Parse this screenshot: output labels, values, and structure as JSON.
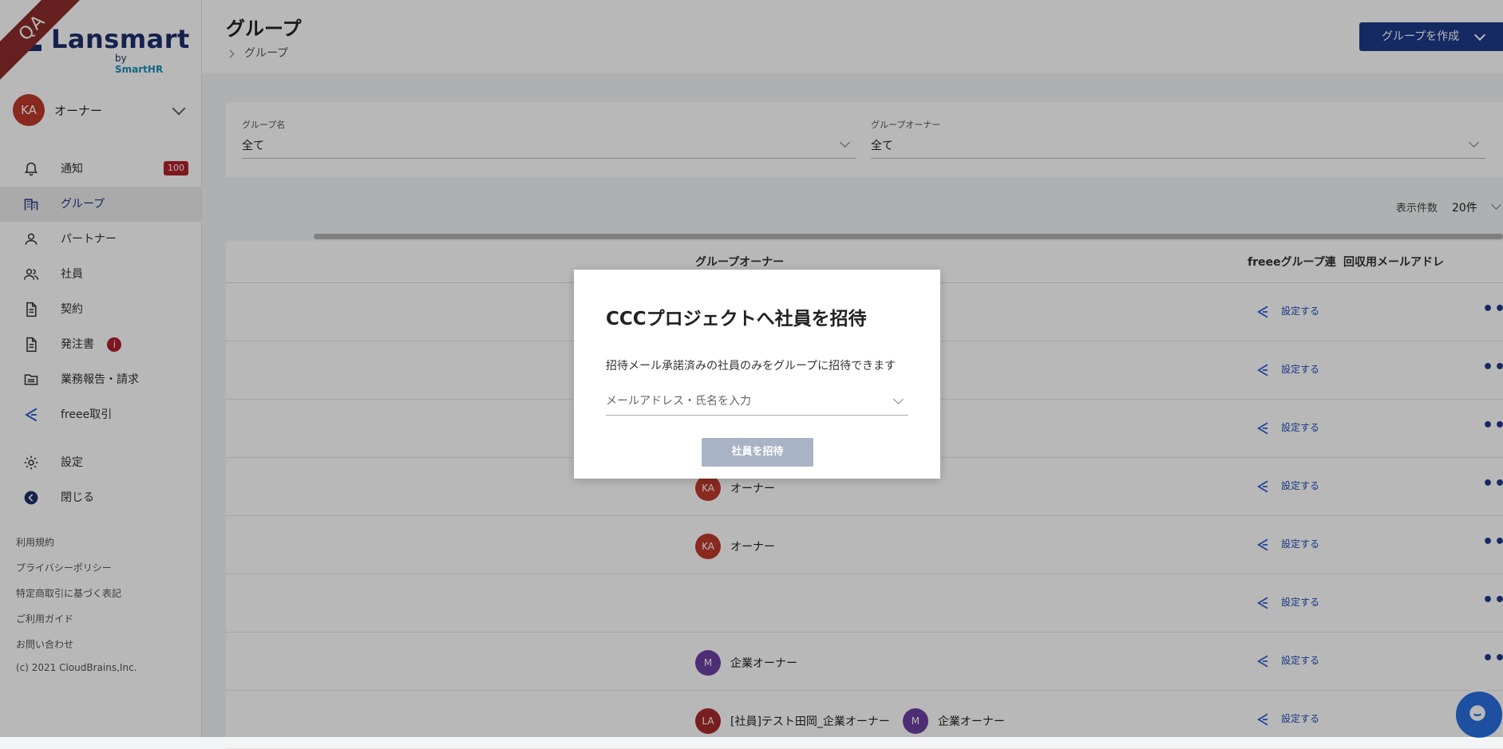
{
  "ribbon": "QA",
  "logo": {
    "name": "Lansmart",
    "by": "by",
    "brand": "SmartHR"
  },
  "user": {
    "avatar": "KA",
    "role": "オーナー"
  },
  "nav": [
    {
      "label": "通知",
      "badge": "100"
    },
    {
      "label": "グループ"
    },
    {
      "label": "パートナー"
    },
    {
      "label": "社員"
    },
    {
      "label": "契約"
    },
    {
      "label": "発注書",
      "info": "i"
    },
    {
      "label": "業務報告・請求"
    },
    {
      "label": "freee取引"
    },
    {
      "label": "設定"
    },
    {
      "label": "閉じる"
    }
  ],
  "footer_links": [
    "利用規約",
    "プライバシーポリシー",
    "特定商取引に基づく表記",
    "ご利用ガイド",
    "お問い合わせ"
  ],
  "copyright": "(c) 2021 CloudBrains,Inc.",
  "header": {
    "title": "グループ",
    "breadcrumb": "グループ",
    "create_button": "グループを作成"
  },
  "filters": {
    "group_name": {
      "label": "グループ名",
      "value": "全て"
    },
    "group_owner": {
      "label": "グループオーナー",
      "value": "全て"
    }
  },
  "display_count": {
    "label": "表示件数",
    "value": "20件"
  },
  "table": {
    "columns": {
      "owner": "グループオーナー",
      "freee": "freeeグループ連",
      "mail": "回収用メールアドレ"
    },
    "action_label": "設定する",
    "rows": [
      {
        "owners": []
      },
      {
        "owners": []
      },
      {
        "owners": []
      },
      {
        "owners": [
          {
            "initials": "KA",
            "name": "オーナー",
            "color": "#c0392b"
          }
        ]
      },
      {
        "owners": [
          {
            "initials": "KA",
            "name": "オーナー",
            "color": "#c0392b"
          }
        ]
      },
      {
        "owners": []
      },
      {
        "owners": [
          {
            "initials": "M",
            "name": "企業オーナー",
            "color": "#6b3fa0"
          }
        ]
      },
      {
        "owners": [
          {
            "initials": "LA",
            "name": "[社員]テスト田岡_企業オーナー",
            "color": "#a52a2a"
          },
          {
            "initials": "M",
            "name": "企業オーナー",
            "color": "#6b3fa0"
          }
        ]
      }
    ]
  },
  "modal": {
    "title": "CCCプロジェクトへ社員を招待",
    "description": "招待メール承諾済みの社員のみをグループに招待できます",
    "input_placeholder": "メールアドレス・氏名を入力",
    "submit": "社員を招待"
  },
  "colors": {
    "primary": "#1e3a8a",
    "badge": "#b21f2d",
    "disabled": "#a9b3c6"
  }
}
